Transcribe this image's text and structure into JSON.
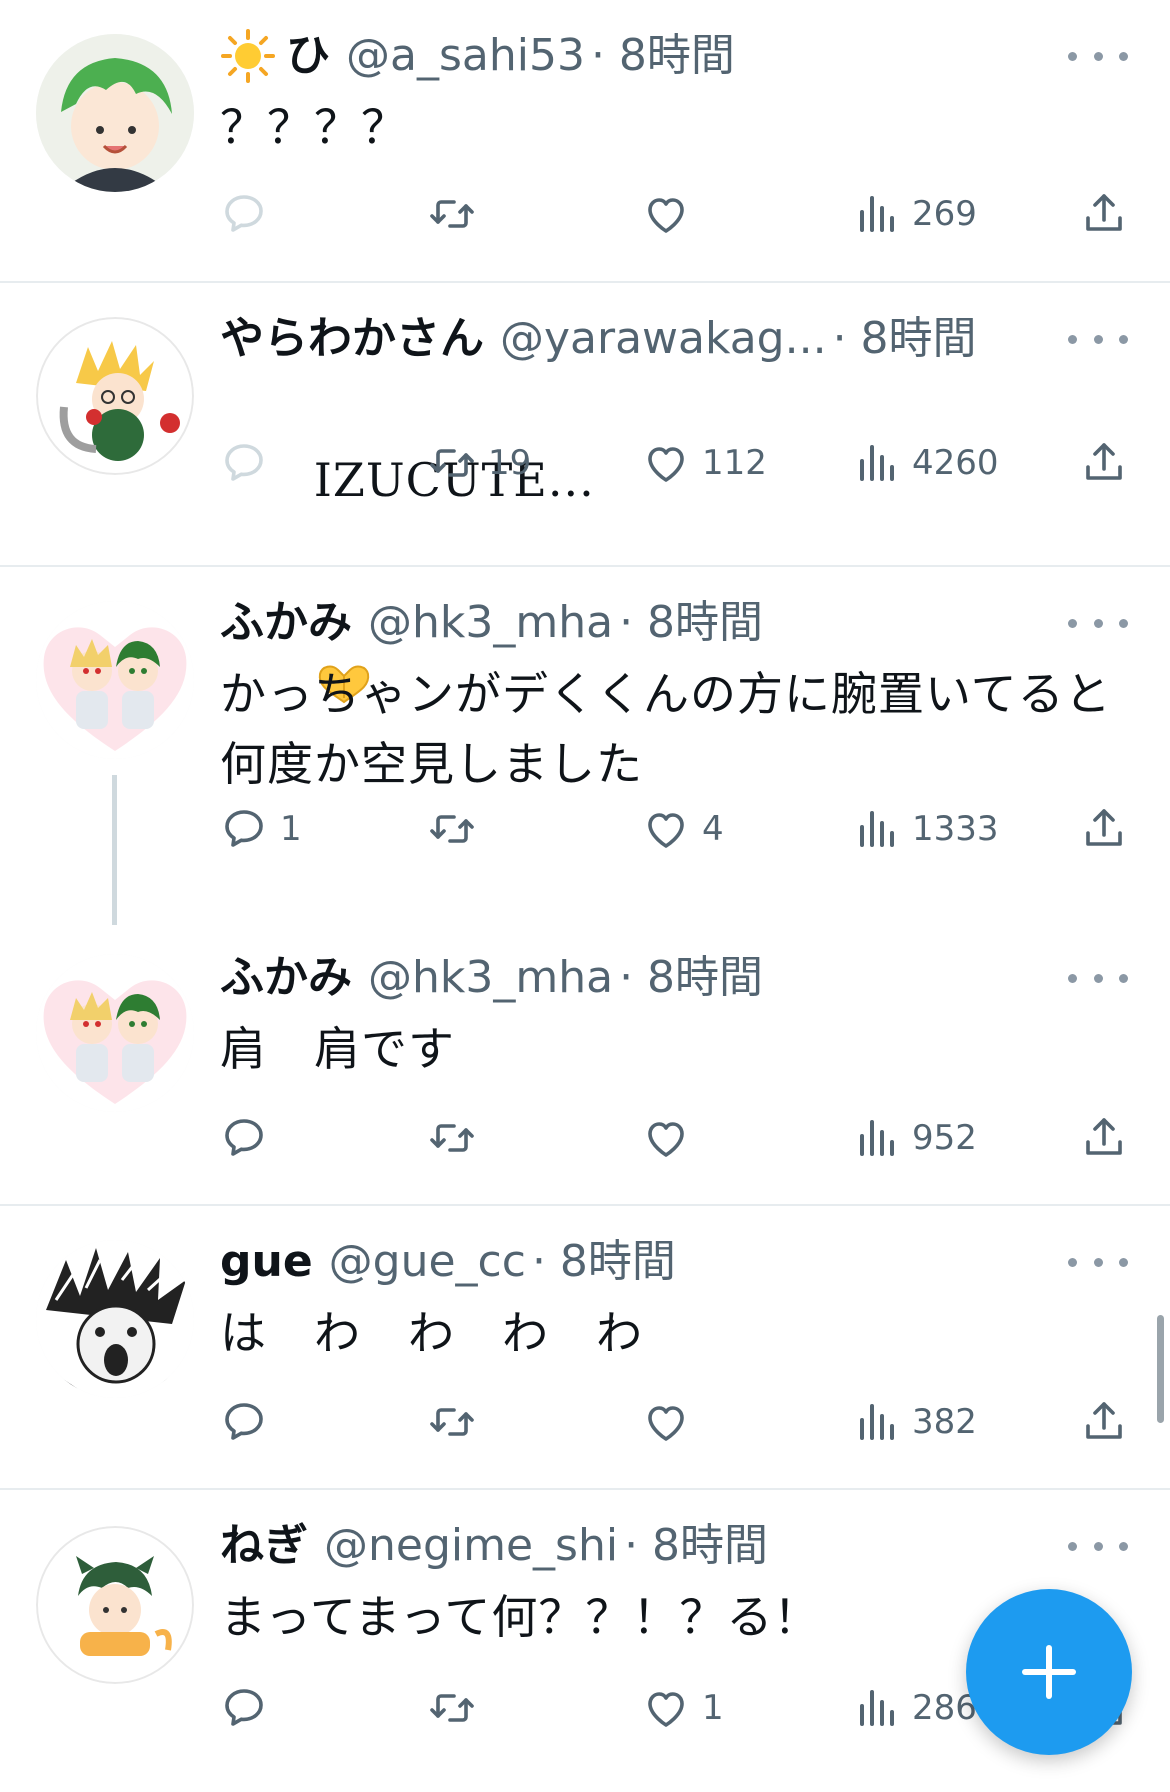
{
  "colors": {
    "accent": "#1d9bf0",
    "secondary_text": "#536471",
    "divider": "#e7ecef"
  },
  "tweets": [
    {
      "name": "ひ",
      "name_icon": "sun-emoji",
      "handle": "@a_sahi53",
      "time": "· 8時間",
      "text": "？？？？",
      "replies": "",
      "retweets": "",
      "likes": "",
      "views": "269"
    },
    {
      "name": "やらわかさん",
      "handle": "@yarawakag...",
      "time": "· 8時間",
      "text": "IZUCUTE...",
      "text_emoji": "heart-hands-emoji",
      "replies": "",
      "retweets": "19",
      "likes": "112",
      "views": "4260"
    },
    {
      "name": "ふかみ",
      "handle": "@hk3_mha",
      "time": "· 8時間",
      "text": "かっちゃンがデくくんの方に腕置いてると何度か空見しました",
      "replies": "1",
      "retweets": "",
      "likes": "4",
      "views": "1333"
    },
    {
      "name": "ふかみ",
      "handle": "@hk3_mha",
      "time": "· 8時間",
      "text": "肩　肩です",
      "replies": "",
      "retweets": "",
      "likes": "",
      "views": "952"
    },
    {
      "name": "gue",
      "handle": "@gue_cc",
      "time": "· 8時間",
      "text": "は　わ　わ　わ　わ",
      "replies": "",
      "retweets": "",
      "likes": "",
      "views": "382"
    },
    {
      "name": "ねぎ",
      "handle": "@negime_shi",
      "time": "· 8時間",
      "text": "まってまって何？？！？る！",
      "replies": "",
      "retweets": "",
      "likes": "1",
      "views": "286"
    }
  ],
  "icons": {
    "reply": "reply-icon",
    "retweet": "retweet-icon",
    "like": "like-icon",
    "views": "views-icon",
    "share": "share-icon",
    "more": "more-icon",
    "compose": "compose-plus-icon"
  }
}
